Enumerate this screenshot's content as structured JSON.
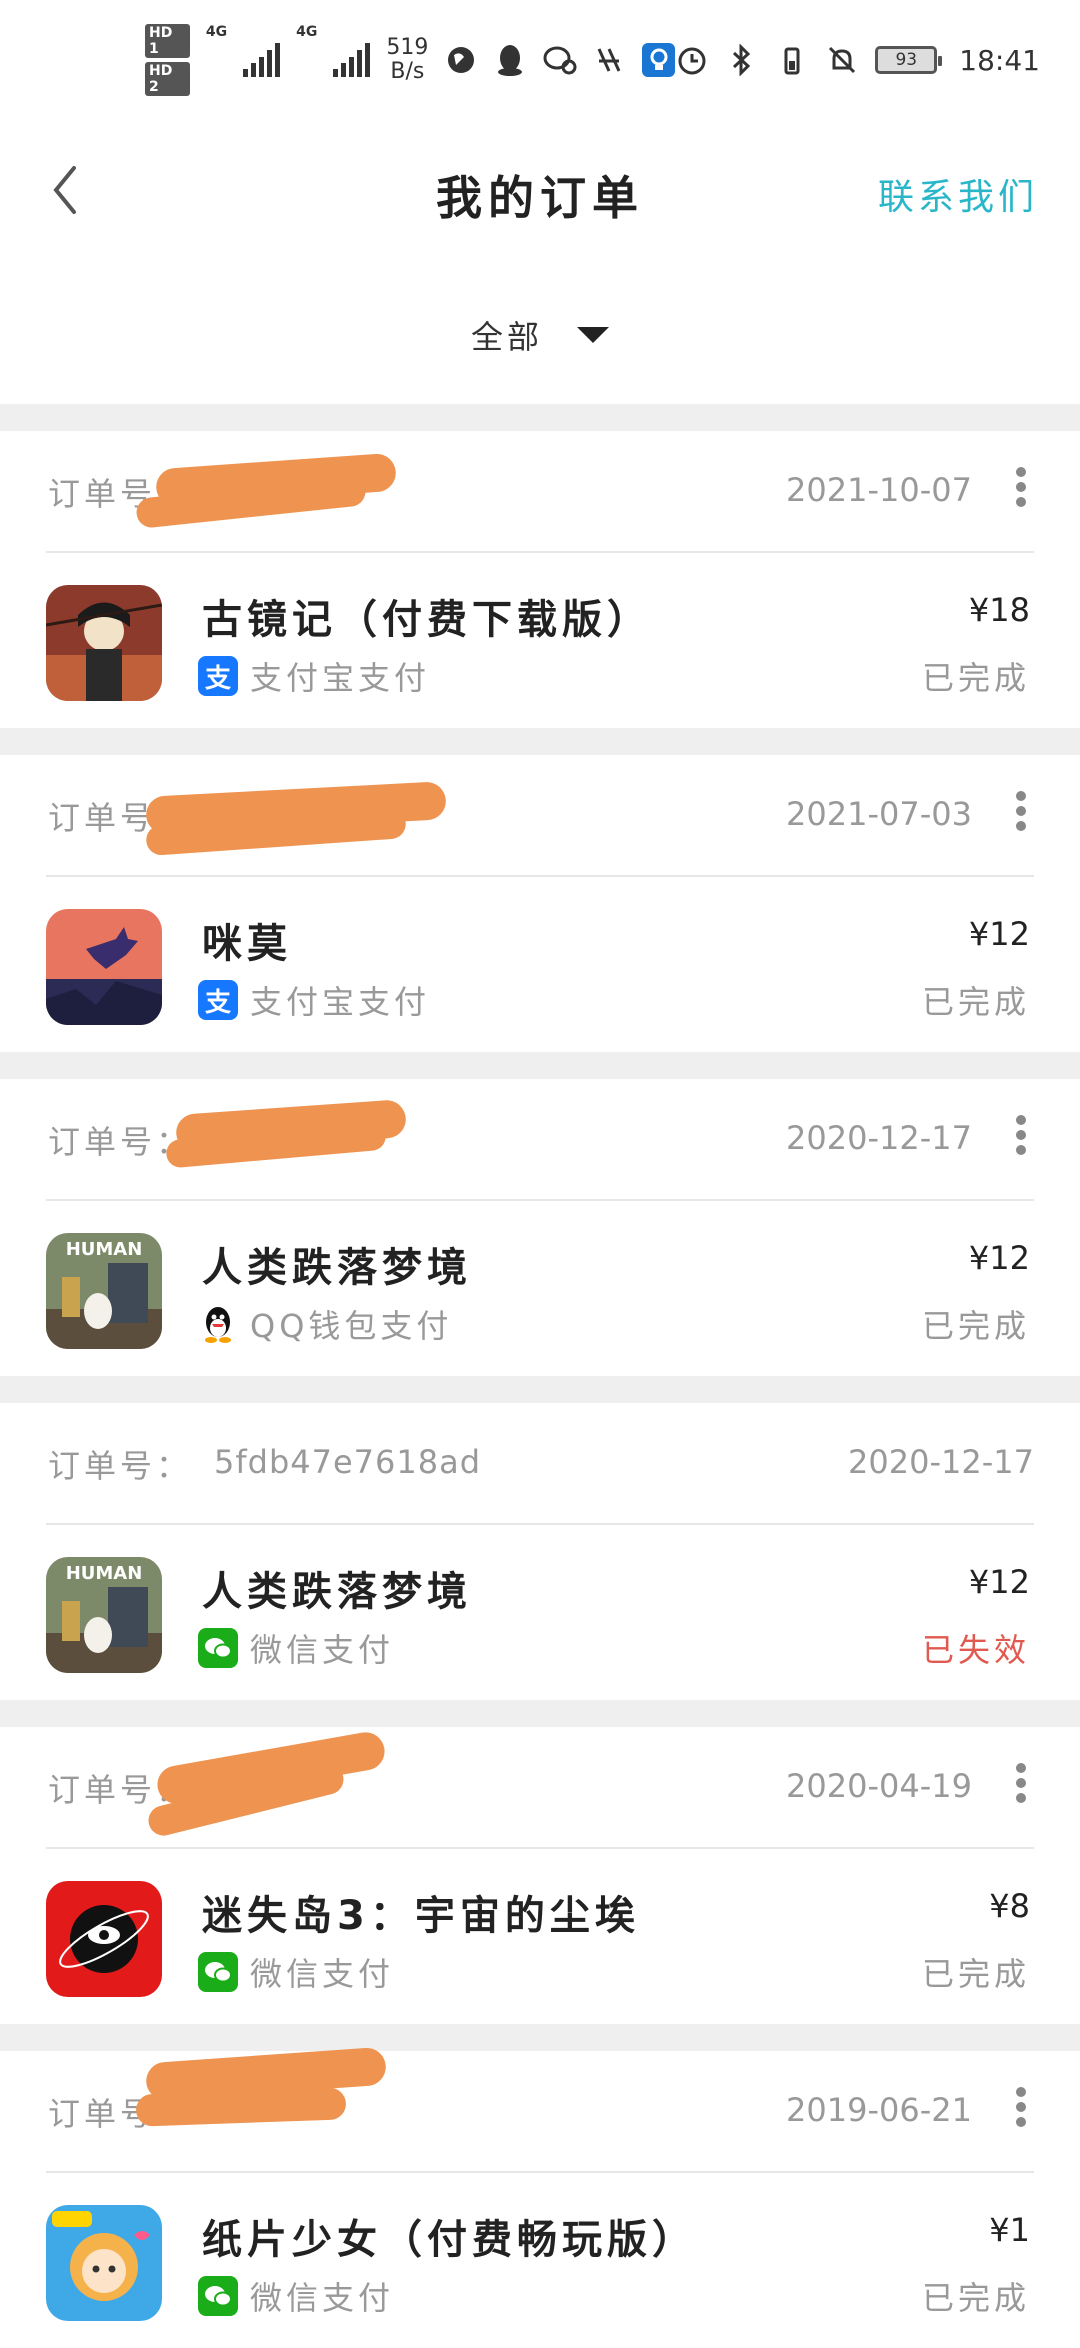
{
  "statusbar": {
    "net1": "4G",
    "net2": "4G",
    "speed_value": "519",
    "speed_unit": "B/s",
    "battery": "93",
    "time": "18:41"
  },
  "header": {
    "title": "我的订单",
    "contact": "联系我们"
  },
  "filter": {
    "label": "全部"
  },
  "orders": [
    {
      "order_no_label": "订单号：",
      "order_no": "",
      "date": "2021-10-07",
      "app_name": "古镜记（付费下载版）",
      "pay_method": "支付宝支付",
      "pay_icon": "alipay-icon",
      "price": "¥18",
      "status": "已完成"
    },
    {
      "order_no_label": "订单号：",
      "order_no": "",
      "date": "2021-07-03",
      "app_name": "咪莫",
      "pay_method": "支付宝支付",
      "pay_icon": "alipay-icon",
      "price": "¥12",
      "status": "已完成"
    },
    {
      "order_no_label": "订单号：",
      "order_no": "",
      "date": "2020-12-17",
      "app_name": "人类跌落梦境",
      "pay_method": "QQ钱包支付",
      "pay_icon": "qq-penguin-icon",
      "price": "¥12",
      "status": "已完成"
    },
    {
      "order_no_label": "订单号：",
      "order_no": "5fdb47e7618ad",
      "date": "2020-12-17",
      "app_name": "人类跌落梦境",
      "pay_method": "微信支付",
      "pay_icon": "wechat-icon",
      "price": "¥12",
      "status": "已失效"
    },
    {
      "order_no_label": "订单号：",
      "order_no": "",
      "date": "2020-04-19",
      "app_name": "迷失岛3：宇宙的尘埃",
      "pay_method": "微信支付",
      "pay_icon": "wechat-icon",
      "price": "¥8",
      "status": "已完成"
    },
    {
      "order_no_label": "订单号：",
      "order_no": "",
      "date": "2019-06-21",
      "app_name": "纸片少女（付费畅玩版）",
      "pay_method": "微信支付",
      "pay_icon": "wechat-icon",
      "price": "¥1",
      "status": "已完成"
    }
  ],
  "colors": {
    "accent": "#29b6c8",
    "failed": "#e05a4f",
    "redaction": "#ef9350",
    "alipay": "#1677ff",
    "wechat": "#1aad19"
  }
}
